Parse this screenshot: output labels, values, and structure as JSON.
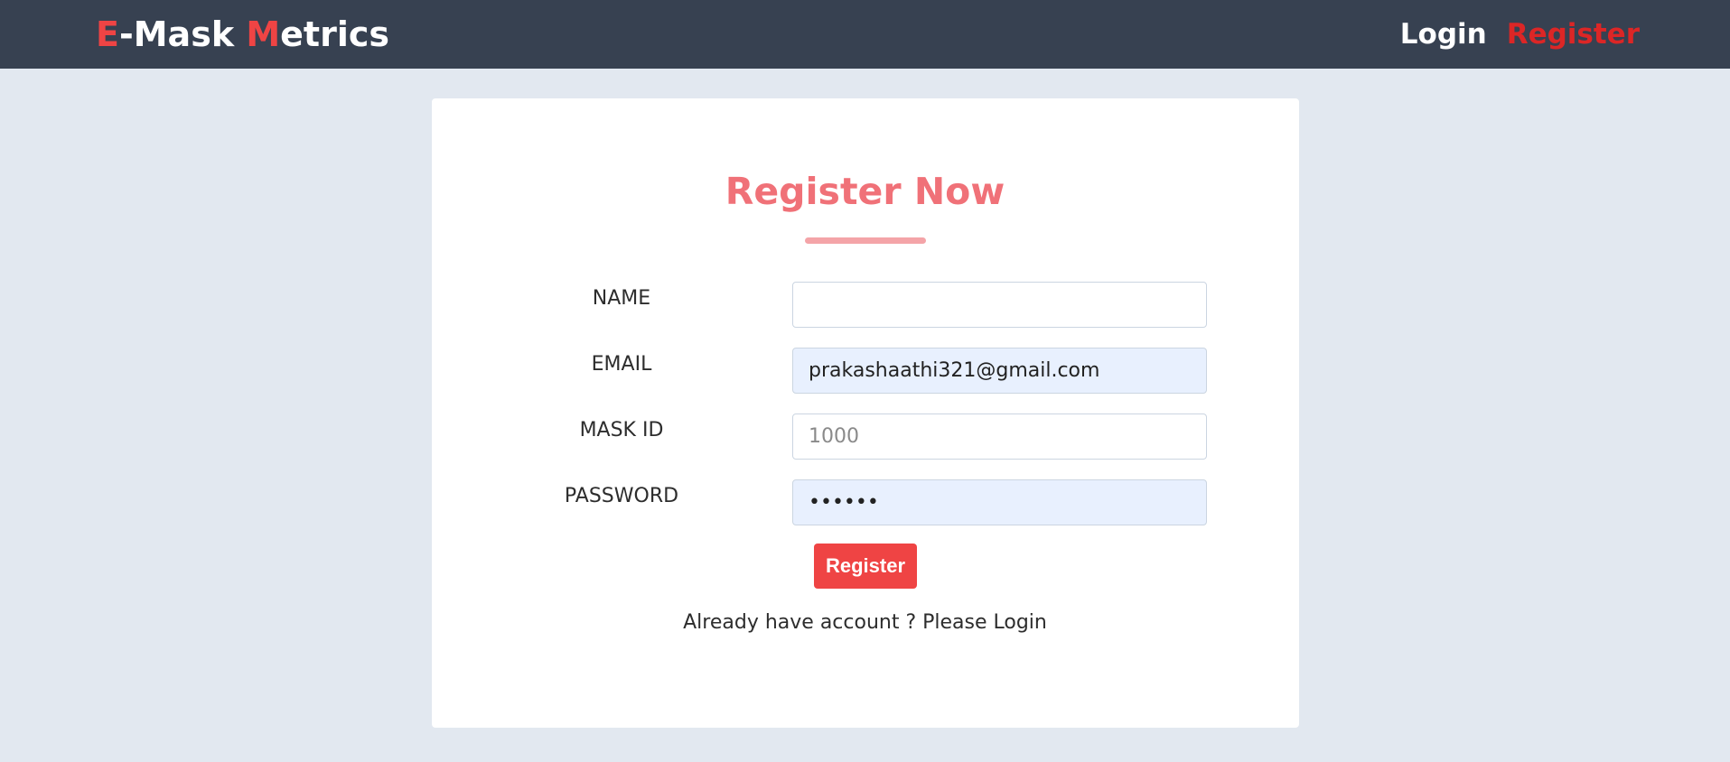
{
  "brand": {
    "part1": "E",
    "part2": "-Mask ",
    "part3": "M",
    "part4": "etrics"
  },
  "nav": {
    "login": "Login",
    "register": "Register"
  },
  "form": {
    "title": "Register Now",
    "fields": [
      {
        "label": "NAME",
        "value": "",
        "placeholder": ""
      },
      {
        "label": "EMAIL",
        "value": "prakashaathi321@gmail.com",
        "placeholder": ""
      },
      {
        "label": "MASK ID",
        "value": "",
        "placeholder": "1000"
      },
      {
        "label": "PASSWORD",
        "value": "abcdef",
        "placeholder": ""
      }
    ],
    "submit_label": "Register",
    "login_prompt": "Already have account ? Please Login"
  },
  "colors": {
    "header_bg": "#374151",
    "accent": "#ef4444",
    "title": "#f07178",
    "page_bg": "#e2e8f0",
    "autofill_bg": "#e8f0fe"
  }
}
